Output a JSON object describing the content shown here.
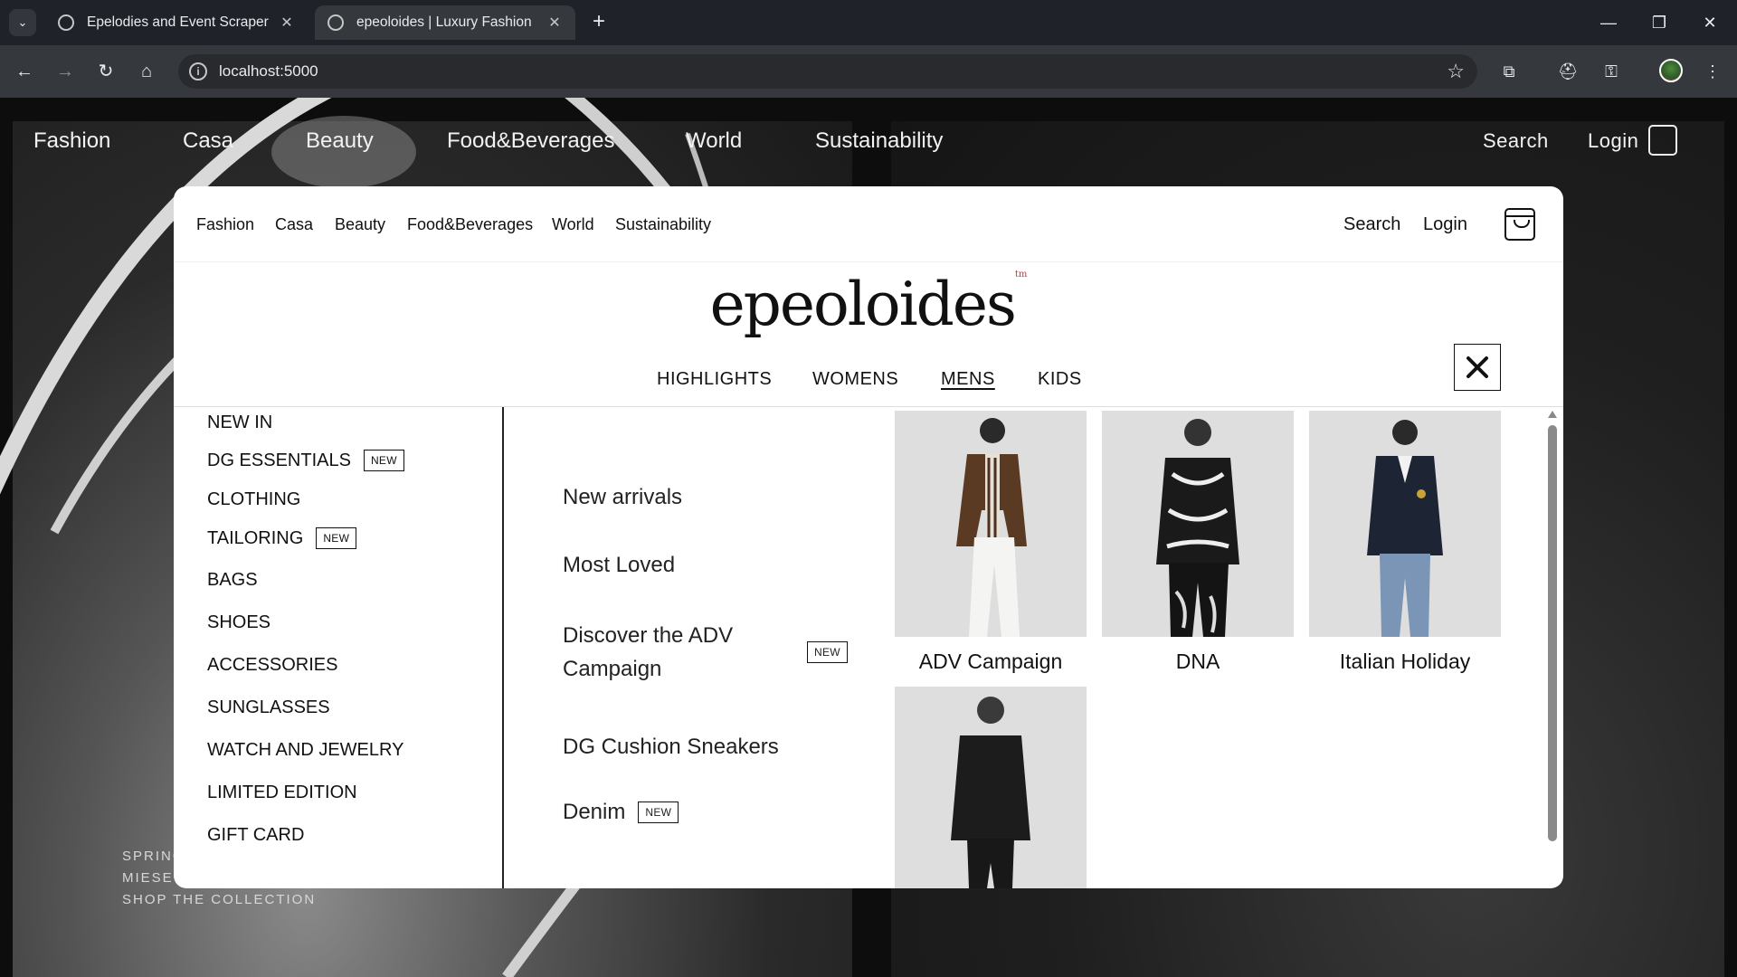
{
  "browser": {
    "tabs": [
      {
        "title": "Epelodies and Event Scraper",
        "active": false
      },
      {
        "title": "epeoloides | Luxury Fashion",
        "active": true
      }
    ],
    "url": "localhost:5000"
  },
  "background_page": {
    "nav": [
      "Fashion",
      "Casa",
      "Beauty",
      "Food&Beverages",
      "World",
      "Sustainability"
    ],
    "search_label": "Search",
    "login_label": "Login",
    "captions": [
      "SPRING",
      "MIESE",
      "SHOP THE COLLECTION"
    ]
  },
  "modal": {
    "nav": [
      "Fashion",
      "Casa",
      "Beauty",
      "Food&Beverages",
      "World",
      "Sustainability"
    ],
    "search_label": "Search",
    "login_label": "Login",
    "logo": "epeoloides",
    "logo_mark": "tm",
    "categories": [
      "HIGHLIGHTS",
      "WOMENS",
      "MENS",
      "KIDS"
    ],
    "selected_category": "MENS",
    "left_menu": [
      {
        "label": "NEW IN",
        "badge": ""
      },
      {
        "label": "DG ESSENTIALS",
        "badge": "NEW"
      },
      {
        "label": "CLOTHING",
        "badge": ""
      },
      {
        "label": "TAILORING",
        "badge": "NEW"
      },
      {
        "label": "BAGS",
        "badge": ""
      },
      {
        "label": "SHOES",
        "badge": ""
      },
      {
        "label": "ACCESSORIES",
        "badge": ""
      },
      {
        "label": "SUNGLASSES",
        "badge": ""
      },
      {
        "label": "WATCH AND JEWELRY",
        "badge": ""
      },
      {
        "label": "LIMITED EDITION",
        "badge": ""
      },
      {
        "label": "GIFT CARD",
        "badge": ""
      }
    ],
    "middle_menu": [
      {
        "label": "New arrivals",
        "badge": ""
      },
      {
        "label": "Most Loved",
        "badge": ""
      },
      {
        "label": "Discover the ADV Campaign",
        "badge": "NEW"
      },
      {
        "label": "DG Cushion Sneakers",
        "badge": ""
      },
      {
        "label": "Denim",
        "badge": "NEW"
      }
    ],
    "cards": [
      {
        "caption": "ADV Campaign",
        "image": "man-brown-jacket-white-trousers"
      },
      {
        "caption": "DNA",
        "image": "man-black-white-print-set"
      },
      {
        "caption": "Italian Holiday",
        "image": "man-navy-blazer-jeans"
      },
      {
        "caption": "",
        "image": "man-black-double-breasted-suit"
      }
    ]
  },
  "colors": {
    "chrome_dark": "#1f2329",
    "chrome_toolbar": "#35383d",
    "modal_bg": "#ffffff",
    "text": "#111111",
    "logo_mark": "#cc3333"
  }
}
